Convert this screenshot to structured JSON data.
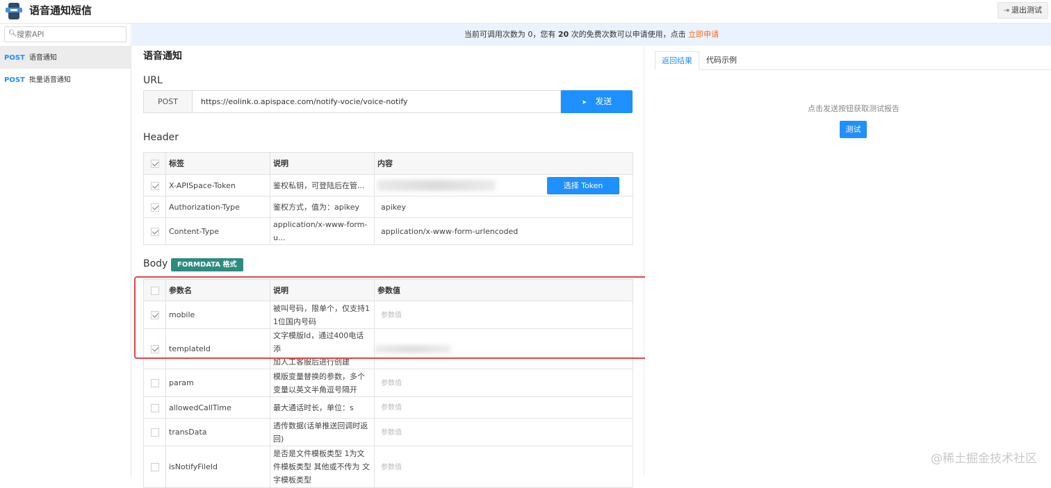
{
  "app": {
    "title": "语音通知短信",
    "exit_label": "退出测试"
  },
  "search": {
    "placeholder": "搜索API"
  },
  "sidebar": {
    "items": [
      {
        "method": "POST",
        "label": "语音通知",
        "active": true
      },
      {
        "method": "POST",
        "label": "批量语音通知",
        "active": false
      }
    ]
  },
  "notice": {
    "prefix": "当前可调用次数为 0，您有",
    "count": "20",
    "suffix": "次的免费次数可以申请使用，点击",
    "link": "立即申请"
  },
  "main": {
    "api_title": "语音通知",
    "url_section": "URL",
    "method": "POST",
    "url": "https://eolink.o.apispace.com/notify-vocie/voice-notify",
    "send_label": "发送",
    "header_section": "Header",
    "header_table": {
      "columns": [
        "标签",
        "说明",
        "内容"
      ],
      "rows": [
        {
          "checked": true,
          "name": "X-APISpace-Token",
          "desc": "鉴权私钥，可登陆后在管...",
          "value": "",
          "button": "选择 Token"
        },
        {
          "checked": true,
          "name": "Authorization-Type",
          "desc": "鉴权方式，值为：apikey",
          "value": "apikey"
        },
        {
          "checked": true,
          "name": "Content-Type",
          "desc": "application/x-www-form-u...",
          "value": "application/x-www-form-urlencoded"
        }
      ]
    },
    "body_section": "Body",
    "body_badge": "FORMDATA 格式",
    "body_table": {
      "columns": [
        "参数名",
        "说明",
        "参数值"
      ],
      "rows": [
        {
          "checked": true,
          "name": "mobile",
          "desc": [
            "被叫号码，限单个，仅支持1",
            "1位国内号码"
          ],
          "placeholder": "参数值"
        },
        {
          "checked": true,
          "name": "templateId",
          "desc": [
            "文字模版Id，通过400电话添",
            "加人工客服后进行创建"
          ],
          "placeholder": ""
        },
        {
          "checked": false,
          "name": "param",
          "desc": [
            "模版变量替换的参数，多个",
            "变量以英文半角逗号隔开"
          ],
          "placeholder": "参数值"
        },
        {
          "checked": false,
          "name": "allowedCallTime",
          "desc": [
            "最大通话时长，单位：s"
          ],
          "placeholder": "参数值"
        },
        {
          "checked": false,
          "name": "transData",
          "desc": [
            "透传数据(话单推送回调时返",
            "回)"
          ],
          "placeholder": "参数值"
        },
        {
          "checked": false,
          "name": "isNotifyFileId",
          "desc": [
            "是否是文件模板类型 1为文",
            "件模板类型 其他或不传为 文",
            "字模板类型"
          ],
          "placeholder": "参数值"
        }
      ]
    }
  },
  "right": {
    "tabs": [
      {
        "label": "返回结果",
        "active": true
      },
      {
        "label": "代码示例",
        "active": false
      }
    ],
    "hint": "点击发送按钮获取测试报告",
    "test_label": "测试"
  },
  "watermark": "@稀土掘金技术社区",
  "colors": {
    "primary": "#1e90ff",
    "badge": "#2e8b7f",
    "highlight": "#e0474b",
    "notice_link": "#ff6a1a"
  }
}
